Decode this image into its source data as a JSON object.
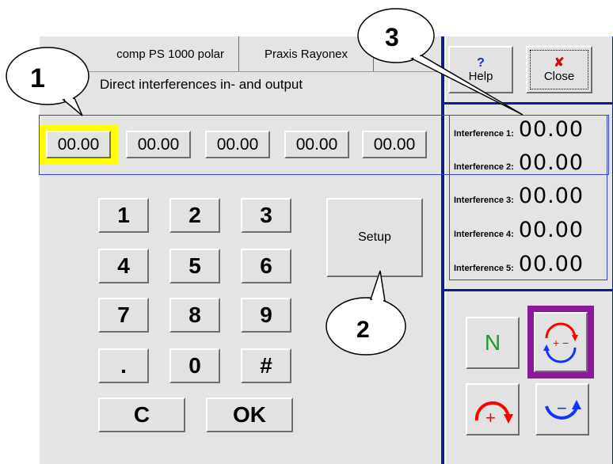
{
  "tabs": [
    {
      "label": "comp PS 1000 polar"
    },
    {
      "label": "Praxis Rayonex"
    }
  ],
  "heading": "Direct interferences in- and output",
  "value_boxes": [
    "00.00",
    "00.00",
    "00.00",
    "00.00",
    "00.00"
  ],
  "keypad": {
    "keys": [
      "1",
      "2",
      "3",
      "4",
      "5",
      "6",
      "7",
      "8",
      "9",
      ".",
      "0",
      "#"
    ],
    "clear": "C",
    "ok": "OK",
    "setup": "Setup"
  },
  "top_buttons": {
    "help": {
      "label": "Help",
      "icon": "question-icon",
      "icon_glyph": "?"
    },
    "close": {
      "label": "Close",
      "icon": "close-x-icon",
      "icon_glyph": "✘"
    }
  },
  "interferences": [
    {
      "label": "Interference 1:",
      "value": "00.00"
    },
    {
      "label": "Interference 2:",
      "value": "00.00"
    },
    {
      "label": "Interference 3:",
      "value": "00.00"
    },
    {
      "label": "Interference 4:",
      "value": "00.00"
    },
    {
      "label": "Interference 5:",
      "value": "00.00"
    }
  ],
  "mode_buttons": {
    "n_label": "N",
    "plus_sign": "+",
    "minus_sign": "−",
    "plus_minus": "+−"
  },
  "callouts": [
    "1",
    "2",
    "3"
  ],
  "colors": {
    "panel": "#e4e4e4",
    "line_blue": "#0a1f8f",
    "frame_blue": "#3344dd",
    "selected_yellow": "#ffff00",
    "selected_purple": "#8b1a9a",
    "n_green": "#1a9a2a",
    "arrow_red": "#ff0000",
    "arrow_blue": "#1133ff"
  }
}
